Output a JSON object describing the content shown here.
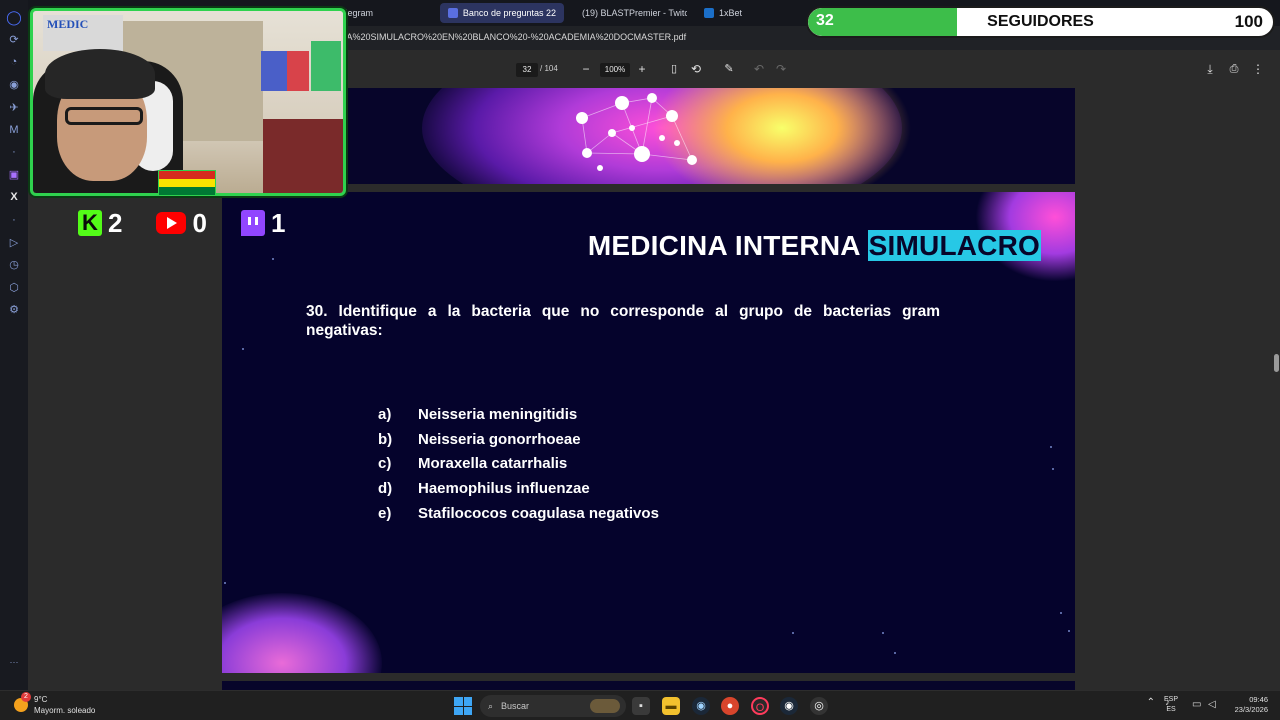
{
  "browser": {
    "tabs": [
      {
        "label": "Telegram"
      },
      {
        "label": "Banco de preguntas 22",
        "active": true
      },
      {
        "label": "(19) BLASTPremier - Twitc"
      },
      {
        "label": "1xBet"
      }
    ],
    "url": "RA%20SIMULACRO%20EN%20BLANCO%20-%20ACADEMIA%20DOCMASTER.pdf"
  },
  "pdf_toolbar": {
    "current_page": "32",
    "total_pages": "/ 104",
    "zoom": "100%"
  },
  "document": {
    "title_main": "MEDICINA INTERNA",
    "title_highlight": "SIMULACRO",
    "question": "30. Identifique a la bacteria que no corresponde al grupo de bacterias gram negativas:",
    "options": [
      {
        "letter": "a)",
        "text": "Neisseria meningitidis"
      },
      {
        "letter": "b)",
        "text": "Neisseria gonorrhoeae"
      },
      {
        "letter": "c)",
        "text": "Moraxella catarrhalis"
      },
      {
        "letter": "d)",
        "text": "Haemophilus influenzae"
      },
      {
        "letter": "e)",
        "text": "Stafilococos coagulasa negativos"
      }
    ]
  },
  "stream_overlay": {
    "counts": {
      "kick": "2",
      "youtube": "0",
      "twitch": "1"
    },
    "followers_goal": {
      "current": "32",
      "label": "SEGUIDORES",
      "target": "100",
      "progress": 0.32,
      "fill_color": "#3dbe4a"
    },
    "webcam_sign": "MEDIC"
  },
  "taskbar": {
    "weather_badge": "2",
    "temperature": "9°C",
    "weather_desc": "Mayorm. soleado",
    "search_placeholder": "Buscar",
    "lang_line1": "ESP",
    "lang_line2": "ES",
    "time": "09:46",
    "date": "23/3/2026"
  },
  "icons": [
    "opera-icon",
    "reload-icon",
    "download-icon",
    "print-icon",
    "search-icon",
    "windows-icon"
  ]
}
